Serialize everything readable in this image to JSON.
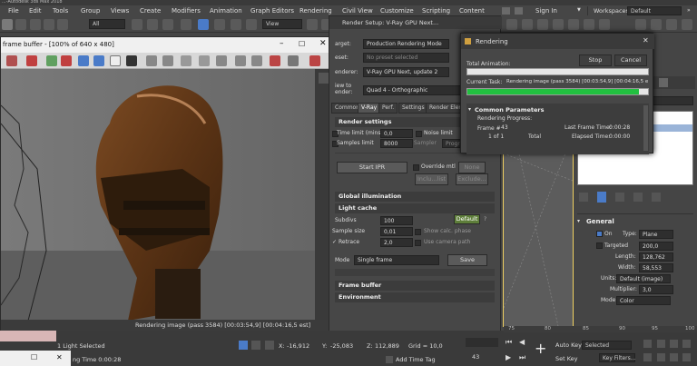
{
  "window_title": "...-Autodesk 3ds Max 2018",
  "menu": [
    "File",
    "Edit",
    "Tools",
    "Group",
    "Views",
    "Create",
    "Modifiers",
    "Animation",
    "Graph Editors",
    "Rendering",
    "Civil View",
    "Customize",
    "Scripting",
    "Content"
  ],
  "sign_in": "Sign In",
  "workspaces_label": "Workspaces:",
  "workspaces_value": "Default",
  "toolbar": {
    "selection_filter": "All",
    "view": "View",
    "num3": "3"
  },
  "frame_buffer": {
    "title": "frame buffer - [100% of 640 x 480]",
    "status": "Rendering image (pass 3584) [00:03:54,9] [00:04:16,5 est]"
  },
  "render_setup": {
    "title": "Render Setup: V-Ray GPU Next...",
    "target_label": "arget:",
    "target_value": "Production Rendering Mode",
    "preset_label": "eset:",
    "preset_value": "No preset selected",
    "renderer_label": "enderer:",
    "renderer_value": "V-Ray GPU Next, update 2",
    "view_label": "iew to ender:",
    "view_value": "Quad 4 - Orthographic",
    "tabs": [
      "Common",
      "V-Ray",
      "Perf.",
      "Settings",
      "Render Elements"
    ],
    "render_settings": {
      "header": "Render settings",
      "time_limit_label": "Time limit (mins)",
      "time_limit_value": "0,0",
      "noise_limit_label": "Noise limit",
      "samples_limit_label": "Samples limit",
      "samples_limit_value": "8000",
      "sampler_label": "Sampler",
      "progressive_label": "Progre...",
      "start_ipr": "Start IPR",
      "override_mtl": "Override mtl",
      "none": "None",
      "inclu_list": "Inclu...list",
      "exclude": "Exclude..."
    },
    "global_illumination": "Global illumination",
    "light_cache": {
      "header": "Light cache",
      "subdivs_label": "Subdivs",
      "subdivs_value": "100",
      "default_btn": "Default",
      "sample_size_label": "Sample size",
      "sample_size_value": "0,01",
      "show_calc_phase": "Show calc. phase",
      "retrace_label": "Retrace",
      "retrace_value": "2,0",
      "use_camera_path": "Use camera path",
      "mode_label": "Mode",
      "mode_value": "Single frame",
      "save_btn": "Save"
    },
    "frame_buffer": "Frame buffer",
    "environment": "Environment"
  },
  "rendering_dialog": {
    "title": "Rendering",
    "stop": "Stop",
    "cancel": "Cancel",
    "total_animation": "Total Animation:",
    "current_task_label": "Current Task:",
    "current_task_value": "Rendering image (pass 3584) [00:03:54,9] [00:04:16,5 e",
    "current_progress": 0.95,
    "common_parameters": "Common Parameters",
    "rendering_progress": "Rendering Progress:",
    "frame_label": "Frame #",
    "frame_value": "43",
    "one_of_one": "1 of 1",
    "total_label": "Total",
    "last_frame_time_label": "Last Frame Time:",
    "last_frame_time_value": "0:00:28",
    "elapsed_time_label": "Elapsed Time:",
    "elapsed_time_value": "0:00:00"
  },
  "general": {
    "header": "General",
    "on_label": "On",
    "type_label": "Type:",
    "type_value": "Plane",
    "targeted_label": "Targeted",
    "targeted_value": "200,0",
    "length_label": "Length:",
    "length_value": "128,762",
    "width_label": "Width:",
    "width_value": "58,553",
    "units_label": "Units:",
    "units_value": "Default (image)",
    "multiplier_label": "Multiplier:",
    "multiplier_value": "3,0",
    "mode_label": "Mode:",
    "mode_value": "Color"
  },
  "timeline_ticks": [
    "75",
    "80",
    "85",
    "90",
    "95",
    "100"
  ],
  "status_bar": {
    "selected": "1 Light Selected",
    "rendering_time": "ng Time 0:00:28",
    "x_label": "X:",
    "x_value": "-16,912",
    "y_label": "Y:",
    "y_value": "-25,083",
    "z_label": "Z:",
    "z_value": "112,889",
    "grid": "Grid = 10,0",
    "add_time_tag": "Add Time Tag",
    "frame_field": "43",
    "auto_key": "Auto Key",
    "selected_value": "Selected",
    "set_key": "Set Key",
    "key_filters": "Key Filters..."
  },
  "colors": {
    "progress_green": "#22c040",
    "viewport_border": "#f0d060",
    "active_blue": "#4a7bc8"
  }
}
